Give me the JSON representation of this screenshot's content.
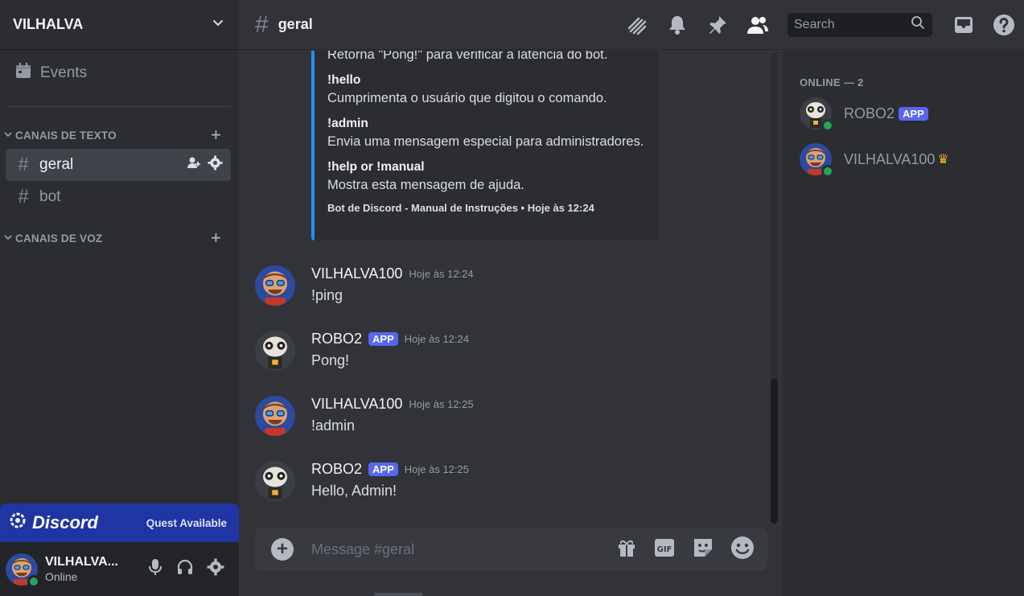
{
  "server": {
    "name": "VILHALVA"
  },
  "sidebar": {
    "events_label": "Events",
    "text_category": "CANAIS DE TEXTO",
    "voice_category": "CANAIS DE VOZ",
    "channels": [
      {
        "name": "geral"
      },
      {
        "name": "bot"
      }
    ]
  },
  "quest": {
    "brand": "Discord",
    "text": "Quest Available"
  },
  "user_panel": {
    "name": "VILHALVA...",
    "status": "Online"
  },
  "topbar": {
    "channel": "geral",
    "search_placeholder": "Search"
  },
  "embed": {
    "partial_line": "Retorna \"Pong!\" para verificar a latência do bot.",
    "commands": [
      {
        "cmd": "!hello",
        "desc": "Cumprimenta o usuário que digitou o comando."
      },
      {
        "cmd": "!admin",
        "desc": "Envia uma mensagem especial para administradores."
      },
      {
        "cmd": "!help or !manual",
        "desc": "Mostra esta mensagem de ajuda."
      }
    ],
    "footer": "Bot de Discord - Manual de Instruções • Hoje às 12:24"
  },
  "messages": [
    {
      "author": "VILHALVA100",
      "time": "Hoje às 12:24",
      "text": "!ping"
    },
    {
      "author": "ROBO2",
      "tag": "APP",
      "time": "Hoje às 12:24",
      "text": "Pong!"
    },
    {
      "author": "VILHALVA100",
      "time": "Hoje às 12:25",
      "text": "!admin"
    },
    {
      "author": "ROBO2",
      "tag": "APP",
      "time": "Hoje às 12:25",
      "text": "Hello, Admin!"
    }
  ],
  "composer": {
    "placeholder": "Message #geral"
  },
  "members": {
    "heading": "ONLINE — 2",
    "list": [
      {
        "name": "ROBO2",
        "tag": "APP"
      },
      {
        "name": "VILHALVA100"
      }
    ]
  },
  "colors": {
    "accent": "#5865f2",
    "online": "#23a55a",
    "embed_border": "#1e90ff",
    "quest_banner": "#1e35a3"
  }
}
